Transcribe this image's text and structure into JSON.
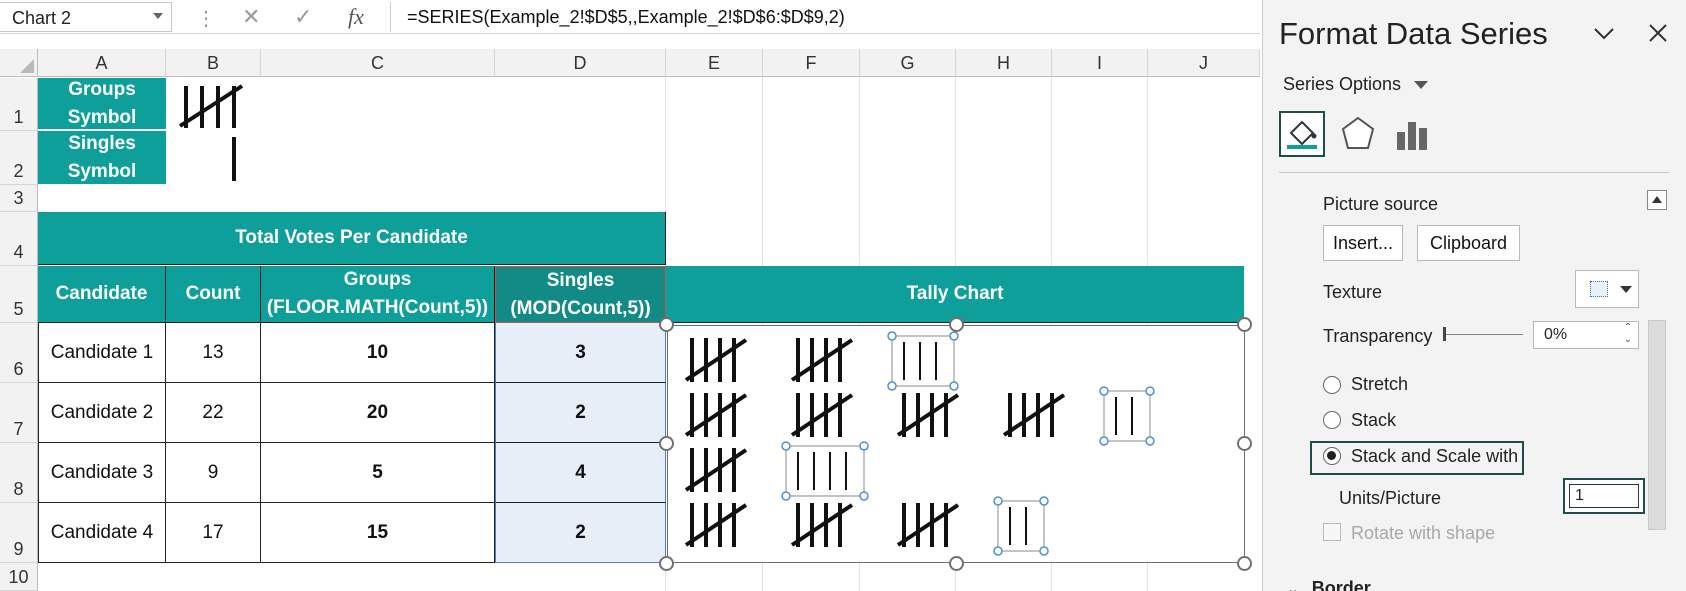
{
  "formula_bar": {
    "name_box": "Chart 2",
    "cancel_icon": "✕",
    "enter_icon": "✓",
    "fx_icon": "fx",
    "formula": "=SERIES(Example_2!$D$5,,Example_2!$D$6:$D$9,2)"
  },
  "columns": [
    "A",
    "B",
    "C",
    "D",
    "E",
    "F",
    "G",
    "H",
    "I",
    "J"
  ],
  "rows": [
    "1",
    "2",
    "3",
    "4",
    "5",
    "6",
    "7",
    "8",
    "9",
    "10"
  ],
  "symbols": {
    "groups_line1": "Groups",
    "groups_line2": "Symbol",
    "singles_line1": "Singles",
    "singles_line2": "Symbol"
  },
  "table": {
    "title": "Total Votes Per Candidate",
    "headers": {
      "candidate": "Candidate",
      "count": "Count",
      "groups_line1": "Groups",
      "groups_line2": "(FLOOR.MATH(Count,5))",
      "singles_line1": "Singles",
      "singles_line2": "(MOD(Count,5))",
      "tally": "Tally Chart"
    },
    "rows": [
      {
        "candidate": "Candidate 1",
        "count": "13",
        "groups": "10",
        "singles": "3"
      },
      {
        "candidate": "Candidate 2",
        "count": "22",
        "groups": "20",
        "singles": "2"
      },
      {
        "candidate": "Candidate 3",
        "count": "9",
        "groups": "5",
        "singles": "4"
      },
      {
        "candidate": "Candidate 4",
        "count": "17",
        "groups": "15",
        "singles": "2"
      }
    ]
  },
  "chart_data": {
    "type": "bar",
    "categories": [
      "Candidate 1",
      "Candidate 2",
      "Candidate 3",
      "Candidate 4"
    ],
    "series": [
      {
        "values": [
          10,
          20,
          5,
          15
        ]
      },
      {
        "values": [
          3,
          2,
          4,
          2
        ]
      }
    ],
    "fill": "picture",
    "units_per_picture": 1
  },
  "pane": {
    "title": "Format Data Series",
    "collapse_icon": "chevron-down-icon",
    "close_icon": "close-icon",
    "series_options": "Series Options",
    "tabs": [
      "fill-line-icon",
      "effects-icon",
      "series-options-icon"
    ],
    "picture_source": "Picture source",
    "insert_btn": "Insert...",
    "clipboard_btn": "Clipboard",
    "texture": "Texture",
    "transparency": "Transparency",
    "transparency_value": "0%",
    "stretch": "Stretch",
    "stack": "Stack",
    "stack_scale": "Stack and Scale with",
    "units_picture": "Units/Picture",
    "units_value": "1",
    "rotate": "Rotate with shape",
    "border": "Border"
  },
  "colors": {
    "teal": "#0e9f9b",
    "teal_dark": "#128a86",
    "selection_fill": "#e8eef8",
    "focus_border": "#1f4e4a"
  }
}
